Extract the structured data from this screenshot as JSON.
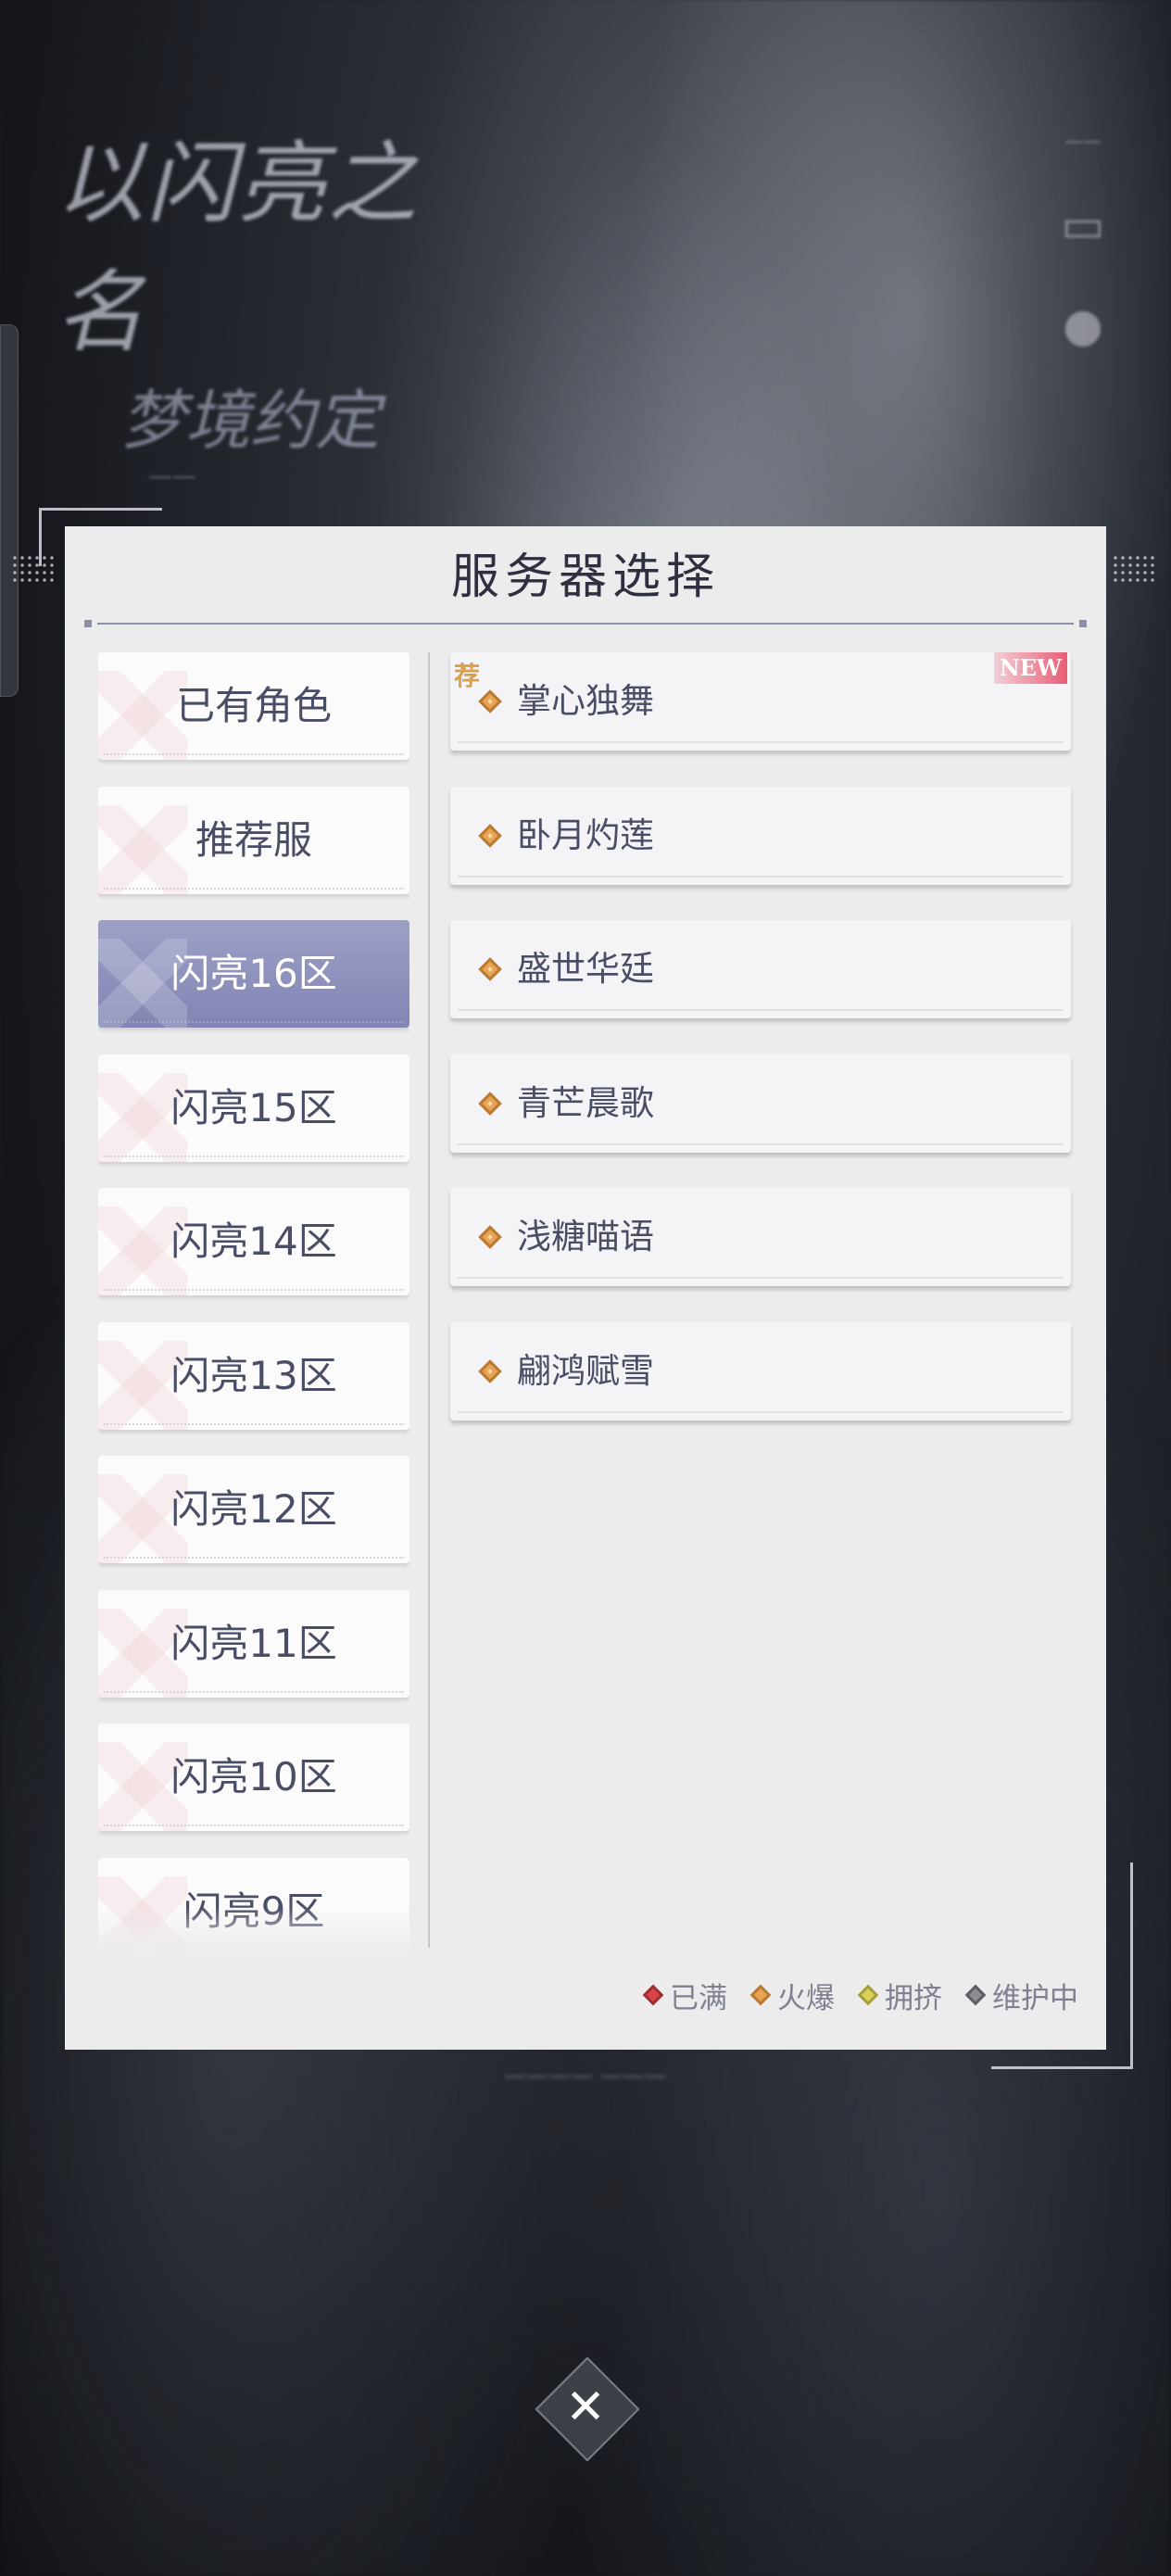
{
  "dialog": {
    "title": "服务器选择"
  },
  "zones": [
    {
      "label": "已有角色",
      "active": false
    },
    {
      "label": "推荐服",
      "active": false
    },
    {
      "label": "闪亮16区",
      "active": true
    },
    {
      "label": "闪亮15区",
      "active": false
    },
    {
      "label": "闪亮14区",
      "active": false
    },
    {
      "label": "闪亮13区",
      "active": false
    },
    {
      "label": "闪亮12区",
      "active": false
    },
    {
      "label": "闪亮11区",
      "active": false
    },
    {
      "label": "闪亮10区",
      "active": false
    },
    {
      "label": "闪亮9区",
      "active": false
    }
  ],
  "servers": [
    {
      "name": "掌心独舞",
      "status": "hot",
      "recommend_badge": "荐",
      "new_badge": "NEW"
    },
    {
      "name": "卧月灼莲",
      "status": "hot"
    },
    {
      "name": "盛世华廷",
      "status": "hot"
    },
    {
      "name": "青芒晨歌",
      "status": "hot"
    },
    {
      "name": "浅糖喵语",
      "status": "hot"
    },
    {
      "name": "翩鸿赋雪",
      "status": "hot"
    }
  ],
  "legend": [
    {
      "label": "已满",
      "color": "#d9464a",
      "border": "#a02d31"
    },
    {
      "label": "火爆",
      "color": "#e8a354",
      "border": "#b97a33"
    },
    {
      "label": "拥挤",
      "color": "#d8d25a",
      "border": "#a6a03a"
    },
    {
      "label": "维护中",
      "color": "#8c8c92",
      "border": "#5e5e64"
    }
  ],
  "close_button": {
    "label": "✕"
  }
}
